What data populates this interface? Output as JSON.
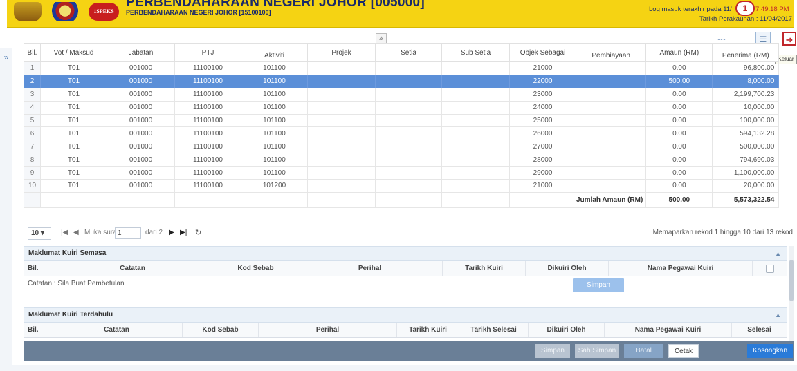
{
  "header": {
    "title": "PERBENDAHARAAN NEGERI JOHOR [005000]",
    "subtitle": "PERBENDAHARAAN NEGERI JOHOR [15100100]",
    "logo_text": "1SPEKS",
    "login_label": "Log masuk terakhir pada 11/",
    "login_time": "7:49:18 PM",
    "accounting_date": "Tarikh Perakaunan : 11/04/2017",
    "notification_count": "1"
  },
  "toolbar": {
    "collapse_symbol": "⩓",
    "tooltip": "Keluar"
  },
  "grid": {
    "columns": [
      "Bil.",
      "Vot / Maksud",
      "Jabatan",
      "PTJ",
      "Aktiviti",
      "Projek",
      "Setia",
      "Sub Setia",
      "Objek Sebagai",
      "Pembiayaan",
      "Amaun (RM)",
      "Penerima (RM)"
    ],
    "rows": [
      [
        "1",
        "T01",
        "001000",
        "11100100",
        "101100",
        "",
        "",
        "",
        "21000",
        "",
        "0.00",
        "96,800.00"
      ],
      [
        "2",
        "T01",
        "001000",
        "11100100",
        "101100",
        "",
        "",
        "",
        "22000",
        "",
        "500.00",
        "8,000.00"
      ],
      [
        "3",
        "T01",
        "001000",
        "11100100",
        "101100",
        "",
        "",
        "",
        "23000",
        "",
        "0.00",
        "2,199,700.23"
      ],
      [
        "4",
        "T01",
        "001000",
        "11100100",
        "101100",
        "",
        "",
        "",
        "24000",
        "",
        "0.00",
        "10,000.00"
      ],
      [
        "5",
        "T01",
        "001000",
        "11100100",
        "101100",
        "",
        "",
        "",
        "25000",
        "",
        "0.00",
        "100,000.00"
      ],
      [
        "6",
        "T01",
        "001000",
        "11100100",
        "101100",
        "",
        "",
        "",
        "26000",
        "",
        "0.00",
        "594,132.28"
      ],
      [
        "7",
        "T01",
        "001000",
        "11100100",
        "101100",
        "",
        "",
        "",
        "27000",
        "",
        "0.00",
        "500,000.00"
      ],
      [
        "8",
        "T01",
        "001000",
        "11100100",
        "101100",
        "",
        "",
        "",
        "28000",
        "",
        "0.00",
        "794,690.03"
      ],
      [
        "9",
        "T01",
        "001000",
        "11100100",
        "101100",
        "",
        "",
        "",
        "29000",
        "",
        "0.00",
        "1,100,000.00"
      ],
      [
        "10",
        "T01",
        "001000",
        "11100100",
        "101200",
        "",
        "",
        "",
        "21000",
        "",
        "0.00",
        "20,000.00"
      ]
    ],
    "selected_row": "2",
    "total_label": "Jumlah Amaun (RM)",
    "total_amount": "500.00",
    "total_recipient": "5,573,322.54"
  },
  "pager": {
    "page_size": "10",
    "page_label": "Muka surat",
    "current_page": "1",
    "of_label": "dari 2",
    "info": "Memaparkan rekod 1 hingga 10 dari 13 rekod"
  },
  "current_query": {
    "title": "Maklumat Kuiri Semasa",
    "columns": [
      "Bil.",
      "Catatan",
      "Kod Sebab",
      "Perihal",
      "Tarikh Kuiri",
      "Dikuiri Oleh",
      "Nama Pegawai Kuiri"
    ],
    "note": "Catatan : Sila Buat Pembetulan",
    "save_label": "Simpan"
  },
  "previous_query": {
    "title": "Maklumat Kuiri Terdahulu",
    "columns": [
      "Bil.",
      "Catatan",
      "Kod Sebab",
      "Perihal",
      "Tarikh Kuiri",
      "Tarikh Selesai",
      "Dikuiri Oleh",
      "Nama Pegawai Kuiri",
      "Selesai"
    ]
  },
  "actions": {
    "simpan": "Simpan",
    "sah_simpan": "Sah Simpan",
    "batal": "Batal",
    "cetak": "Cetak",
    "kosongkan": "Kosongkan"
  }
}
